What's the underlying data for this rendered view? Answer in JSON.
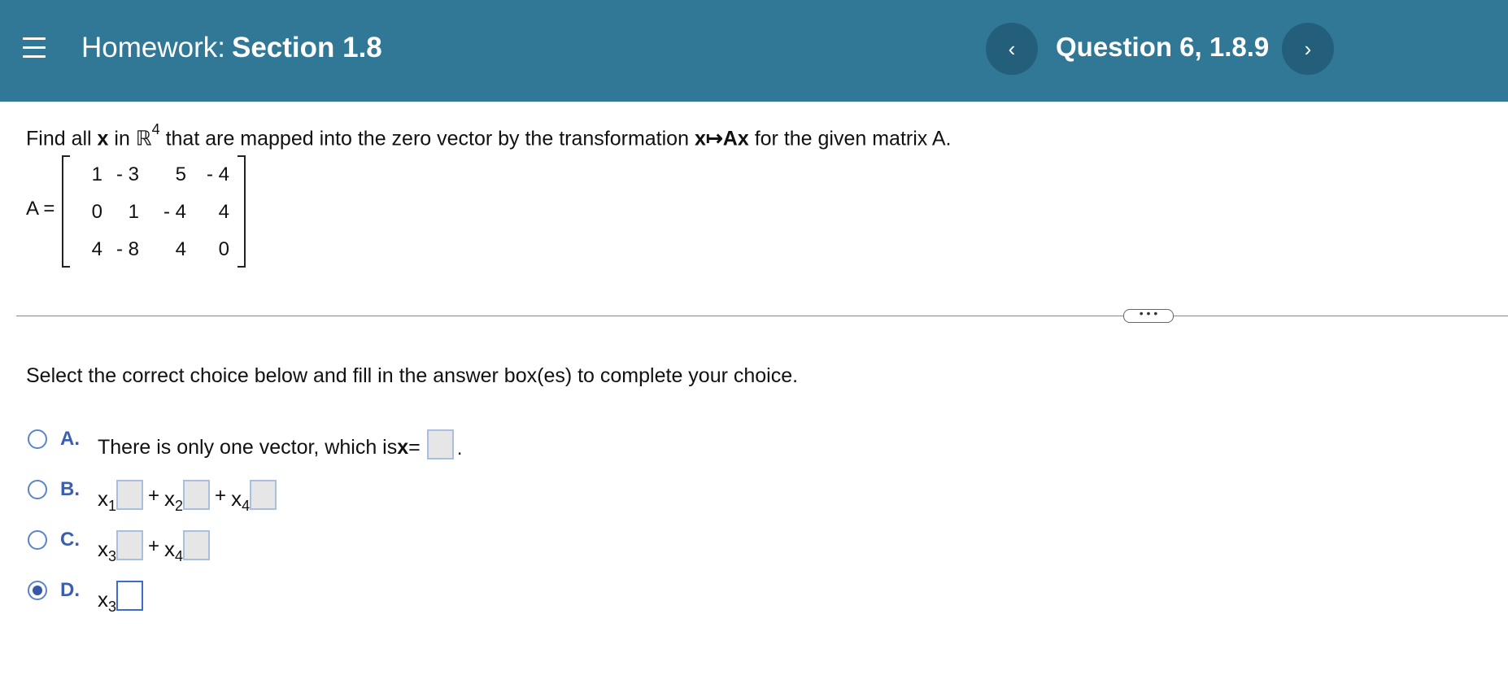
{
  "header": {
    "title_prefix": "Homework:",
    "title_section": "Section 1.8",
    "question_label": "Question 6, 1.8.9",
    "prev_symbol": "‹",
    "next_symbol": "›"
  },
  "problem": {
    "part1": "Find all ",
    "x_bold": "x",
    "part2": " in ℝ",
    "superscript": "4",
    "part3": " that are mapped into the zero vector by the transformation ",
    "map": "x↦Ax",
    "part4": " for the given matrix A.",
    "matrix_label": "A =",
    "matrix": [
      [
        "1",
        "- 3",
        "5",
        "- 4"
      ],
      [
        "0",
        "1",
        "- 4",
        "4"
      ],
      [
        "4",
        "- 8",
        "4",
        "0"
      ]
    ]
  },
  "divider": {
    "more_label": "• • •"
  },
  "instruction": "Select the correct choice below and fill in the answer box(es) to complete your choice.",
  "choices": {
    "a": {
      "letter": "A.",
      "text": "There is only one vector, which is ",
      "x_bold": "x",
      "eq": " =",
      "end": "."
    },
    "b": {
      "letter": "B.",
      "v1": "x",
      "s1": "1",
      "v2": "x",
      "s2": "2",
      "v3": "x",
      "s3": "4",
      "plus": "+"
    },
    "c": {
      "letter": "C.",
      "v1": "x",
      "s1": "3",
      "v2": "x",
      "s2": "4",
      "plus": "+"
    },
    "d": {
      "letter": "D.",
      "v1": "x",
      "s1": "3"
    }
  },
  "selected_choice": "D",
  "colors": {
    "header_bg": "#317796",
    "nav_btn_bg": "#235f7b",
    "choice_letter": "#3a5fb0"
  }
}
